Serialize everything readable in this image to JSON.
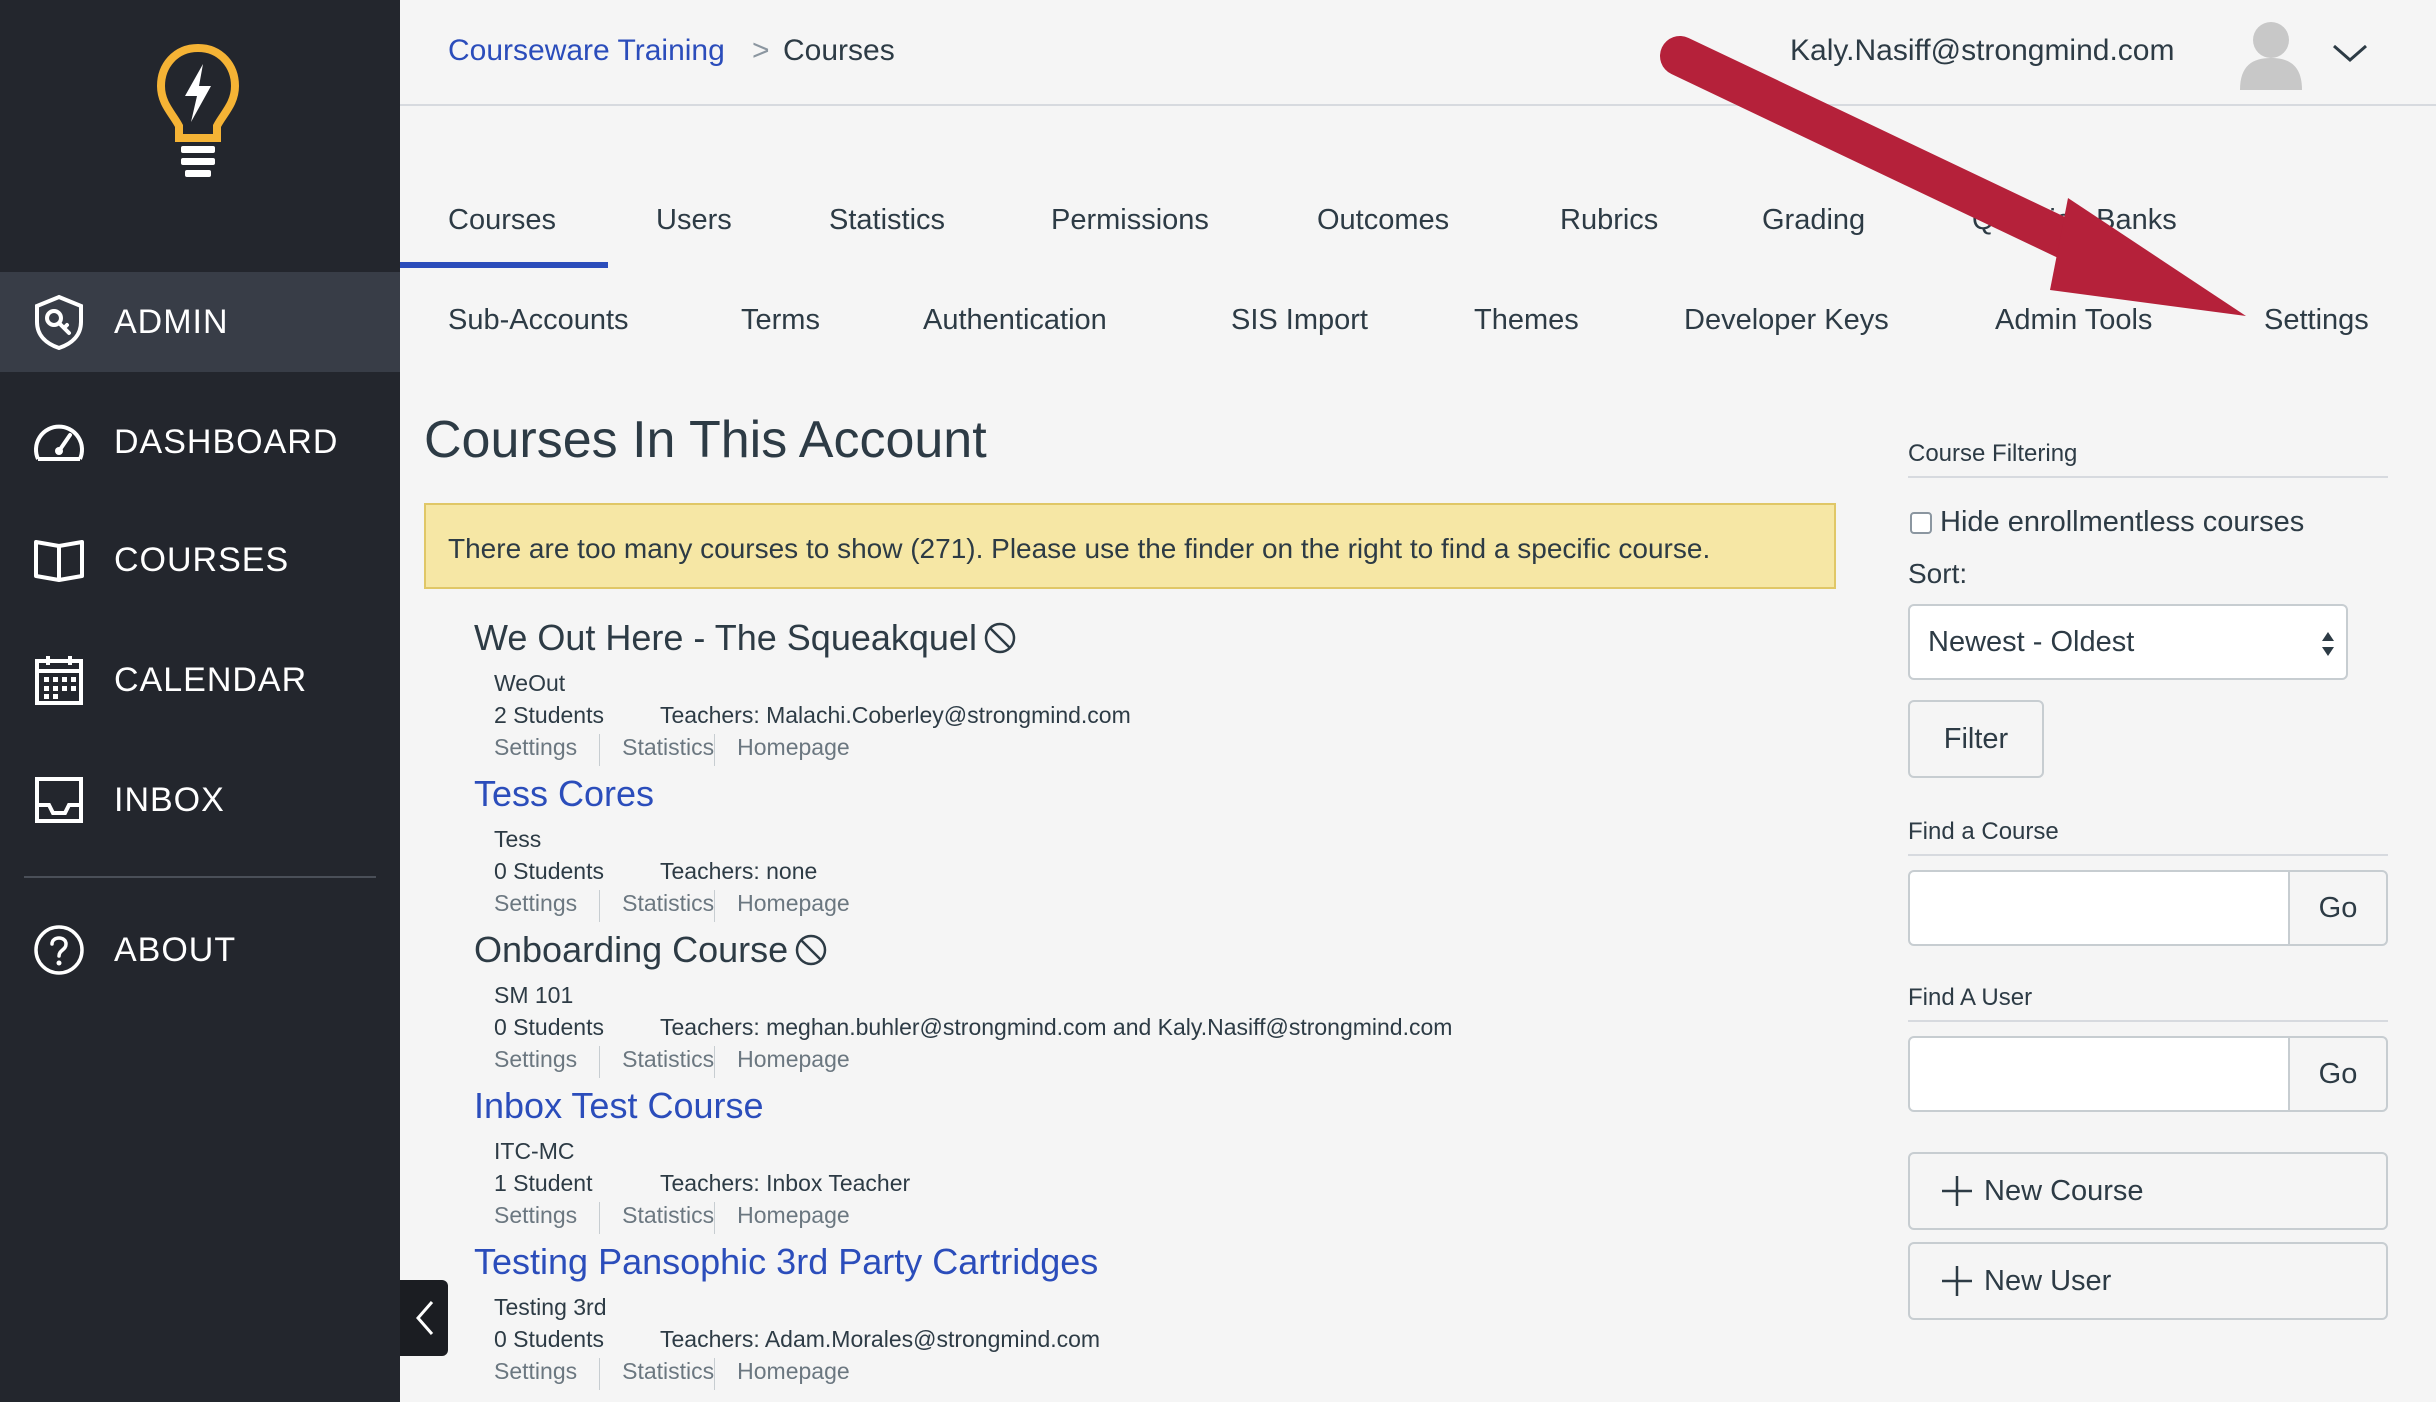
{
  "sidebar": {
    "items": [
      {
        "label": "ADMIN",
        "icon": "admin-shield-icon"
      },
      {
        "label": "DASHBOARD",
        "icon": "speedometer-icon"
      },
      {
        "label": "COURSES",
        "icon": "book-icon"
      },
      {
        "label": "CALENDAR",
        "icon": "calendar-icon"
      },
      {
        "label": "INBOX",
        "icon": "inbox-icon"
      },
      {
        "label": "ABOUT",
        "icon": "question-icon"
      }
    ]
  },
  "header": {
    "breadcrumb": {
      "account": "Courseware Training",
      "separator": ">",
      "current": "Courses"
    },
    "user_email": "Kaly.Nasiff@strongmind.com"
  },
  "tabs_row1": [
    "Courses",
    "Users",
    "Statistics",
    "Permissions",
    "Outcomes",
    "Rubrics",
    "Grading",
    "Question Banks"
  ],
  "tabs_row2": [
    "Sub-Accounts",
    "Terms",
    "Authentication",
    "SIS Import",
    "Themes",
    "Developer Keys",
    "Admin Tools",
    "Settings"
  ],
  "main": {
    "title": "Courses In This Account",
    "alert": "There are too many courses to show (271). Please use the finder on the right to find a specific course.",
    "courses": [
      {
        "name": "We Out Here - The Squeakquel",
        "published": false,
        "code": "WeOut",
        "students": "2 Students",
        "teachers": "Teachers: Malachi.Coberley@strongmind.com"
      },
      {
        "name": "Tess Cores",
        "published": true,
        "code": "Tess",
        "students": "0 Students",
        "teachers": "Teachers: none"
      },
      {
        "name": "Onboarding Course",
        "published": false,
        "code": "SM 101",
        "students": "0 Students",
        "teachers": "Teachers: meghan.buhler@strongmind.com and Kaly.Nasiff@strongmind.com"
      },
      {
        "name": "Inbox Test Course",
        "published": true,
        "code": "ITC-MC",
        "students": "1 Student",
        "teachers": "Teachers: Inbox Teacher"
      },
      {
        "name": "Testing Pansophic 3rd Party Cartridges",
        "published": true,
        "code": "Testing 3rd",
        "students": "0 Students",
        "teachers": "Teachers: Adam.Morales@strongmind.com"
      }
    ],
    "course_links": {
      "settings": "Settings",
      "statistics": "Statistics",
      "homepage": "Homepage"
    }
  },
  "panel": {
    "filtering_heading": "Course Filtering",
    "hide_label": "Hide enrollmentless courses",
    "sort_label": "Sort:",
    "sort_value": "Newest - Oldest",
    "filter_button": "Filter",
    "find_course_heading": "Find a Course",
    "find_user_heading": "Find A User",
    "go_label": "Go",
    "new_course": "New Course",
    "new_user": "New User"
  },
  "colors": {
    "sidebar": "#23262d",
    "link": "#2b4dbb",
    "alert": "#f6e7a5",
    "arrow": "#b5213a",
    "logo": "#f5b335"
  }
}
